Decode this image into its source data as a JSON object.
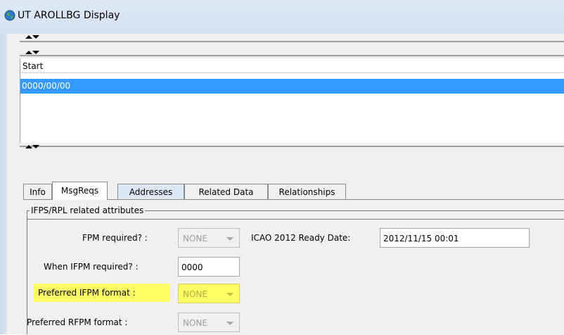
{
  "window": {
    "title": "UT AROLLBG Display",
    "icon": "globe-icon"
  },
  "table": {
    "column_header": "Start",
    "rows": [
      {
        "start": "0000/00/00",
        "selected": true
      }
    ]
  },
  "tabs": [
    {
      "label": "Info",
      "active": false
    },
    {
      "label": "MsgReqs",
      "active": true
    },
    {
      "label": "Addresses",
      "active": false
    },
    {
      "label": "Related Data",
      "active": false
    },
    {
      "label": "Relationships",
      "active": false
    }
  ],
  "group": {
    "title": "IFPS/RPL related attributes",
    "fields": {
      "fpm_required": {
        "label": "FPM required? :",
        "value": "NONE"
      },
      "icao_ready_date": {
        "label": "ICAO 2012 Ready Date:",
        "value": "2012/11/15 00:01"
      },
      "when_ifpm_required": {
        "label": "When IFPM required? :",
        "value": "0000"
      },
      "preferred_ifpm_format": {
        "label": "Preferred IFPM format :",
        "value": "NONE"
      },
      "preferred_rfpm_format": {
        "label": "Preferred RFPM format :",
        "value": "NONE"
      }
    }
  },
  "colors": {
    "selection": "#3399ff",
    "highlight": "#ffff66",
    "titlebar": "#d3e1f1"
  }
}
